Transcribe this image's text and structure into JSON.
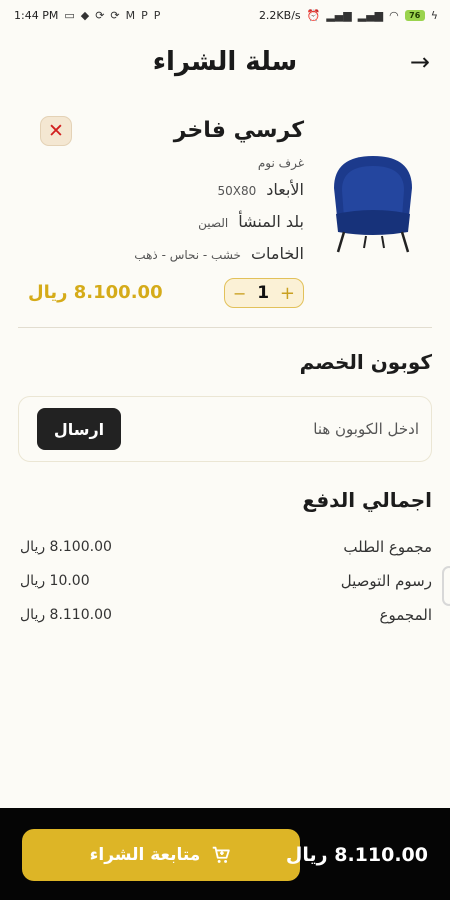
{
  "status_bar": {
    "time": "1:44 PM",
    "speed": "2.2KB/s",
    "battery": "76"
  },
  "header": {
    "title": "سلة الشراء"
  },
  "cart_item": {
    "name": "كرسي فاخر",
    "category": "غرف نوم",
    "dimensions_label": "الأبعاد",
    "dimensions_value": "50X80",
    "origin_label": "بلد المنشأ",
    "origin_value": "الصين",
    "materials_label": "الخامات",
    "materials_value": "خشب - نحاس - ذهب",
    "quantity": "1",
    "price": "8.100.00 ريال"
  },
  "coupon": {
    "title": "كوبون الخصم",
    "placeholder": "ادخل الكوبون هنا",
    "send_label": "ارسال"
  },
  "payment": {
    "title": "اجمالي الدفع",
    "rows": [
      {
        "label": "مجموع الطلب",
        "value": "8.100.00 ريال"
      },
      {
        "label": "رسوم التوصيل",
        "value": "10.00 ريال"
      },
      {
        "label": "المجموع",
        "value": "8.110.00 ريال"
      }
    ]
  },
  "bottom_bar": {
    "checkout_label": "متابعة الشراء",
    "total": "8.110.00 ريال"
  },
  "colors": {
    "accent": "#ddb526",
    "price": "#d5ab19",
    "remove": "#d11f1f"
  }
}
